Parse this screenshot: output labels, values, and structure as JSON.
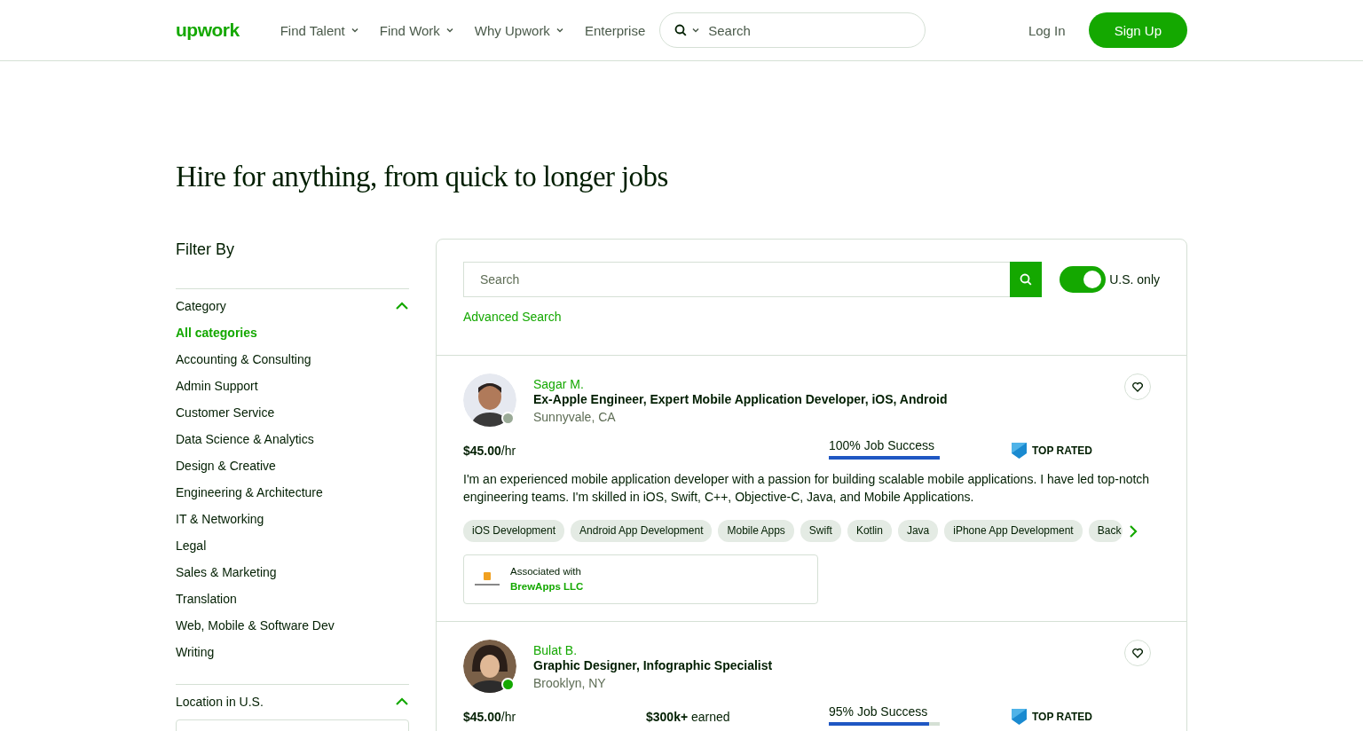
{
  "header": {
    "logo": "upwork",
    "nav": [
      {
        "label": "Find Talent",
        "dropdown": true
      },
      {
        "label": "Find Work",
        "dropdown": true
      },
      {
        "label": "Why Upwork",
        "dropdown": true
      },
      {
        "label": "Enterprise",
        "dropdown": false
      }
    ],
    "search": {
      "placeholder": "Search"
    },
    "login": "Log In",
    "signup": "Sign Up"
  },
  "title": "Hire for anything, from quick to longer jobs",
  "filter": {
    "title": "Filter By",
    "sections": [
      {
        "title": "Category",
        "expanded": true,
        "items": [
          {
            "label": "All categories",
            "selected": true
          },
          {
            "label": "Accounting & Consulting",
            "selected": false
          },
          {
            "label": "Admin Support",
            "selected": false
          },
          {
            "label": "Customer Service",
            "selected": false
          },
          {
            "label": "Data Science & Analytics",
            "selected": false
          },
          {
            "label": "Design & Creative",
            "selected": false
          },
          {
            "label": "Engineering & Architecture",
            "selected": false
          },
          {
            "label": "IT & Networking",
            "selected": false
          },
          {
            "label": "Legal",
            "selected": false
          },
          {
            "label": "Sales & Marketing",
            "selected": false
          },
          {
            "label": "Translation",
            "selected": false
          },
          {
            "label": "Web, Mobile & Software Dev",
            "selected": false
          },
          {
            "label": "Writing",
            "selected": false
          }
        ]
      },
      {
        "title": "Location in U.S.",
        "expanded": true,
        "field": true
      }
    ]
  },
  "search": {
    "placeholder": "Search",
    "toggle": {
      "label": "U.S. only",
      "on": true
    },
    "advanced": "Advanced Search"
  },
  "freelancers": [
    {
      "name": "Sagar M.",
      "title": "Ex-Apple Engineer, Expert Mobile Application Developer, iOS, Android",
      "location": "Sunnyvale, CA",
      "online": false,
      "rate": "**$45.00**/hr",
      "job_success": "100% Job Success",
      "level": 1,
      "badge": "TOP RATED",
      "bio": "I'm an experienced mobile application developer with a passion for building scalable mobile applications. I have led top-notch engineering teams. I'm skilled in iOS, Swift, C++, Objective-C, Java, and Mobile Applications.",
      "skills": [
        "iOS Development",
        "Android App Development",
        "Mobile Apps",
        "Swift",
        "Kotlin",
        "Java",
        "iPhone App Development",
        "Back"
      ],
      "association": {
        "label": "Associated with",
        "company": "BrewApps LLC"
      }
    },
    {
      "name": "Bulat B.",
      "title": "Graphic Designer, Infographic Specialist",
      "location": "Brooklyn, NY",
      "online": true,
      "rate": "**$45.00**/hr",
      "earned": "**$300k+** earned",
      "job_success": "95% Job Success",
      "level": 0.9,
      "badge": "TOP RATED"
    }
  ]
}
